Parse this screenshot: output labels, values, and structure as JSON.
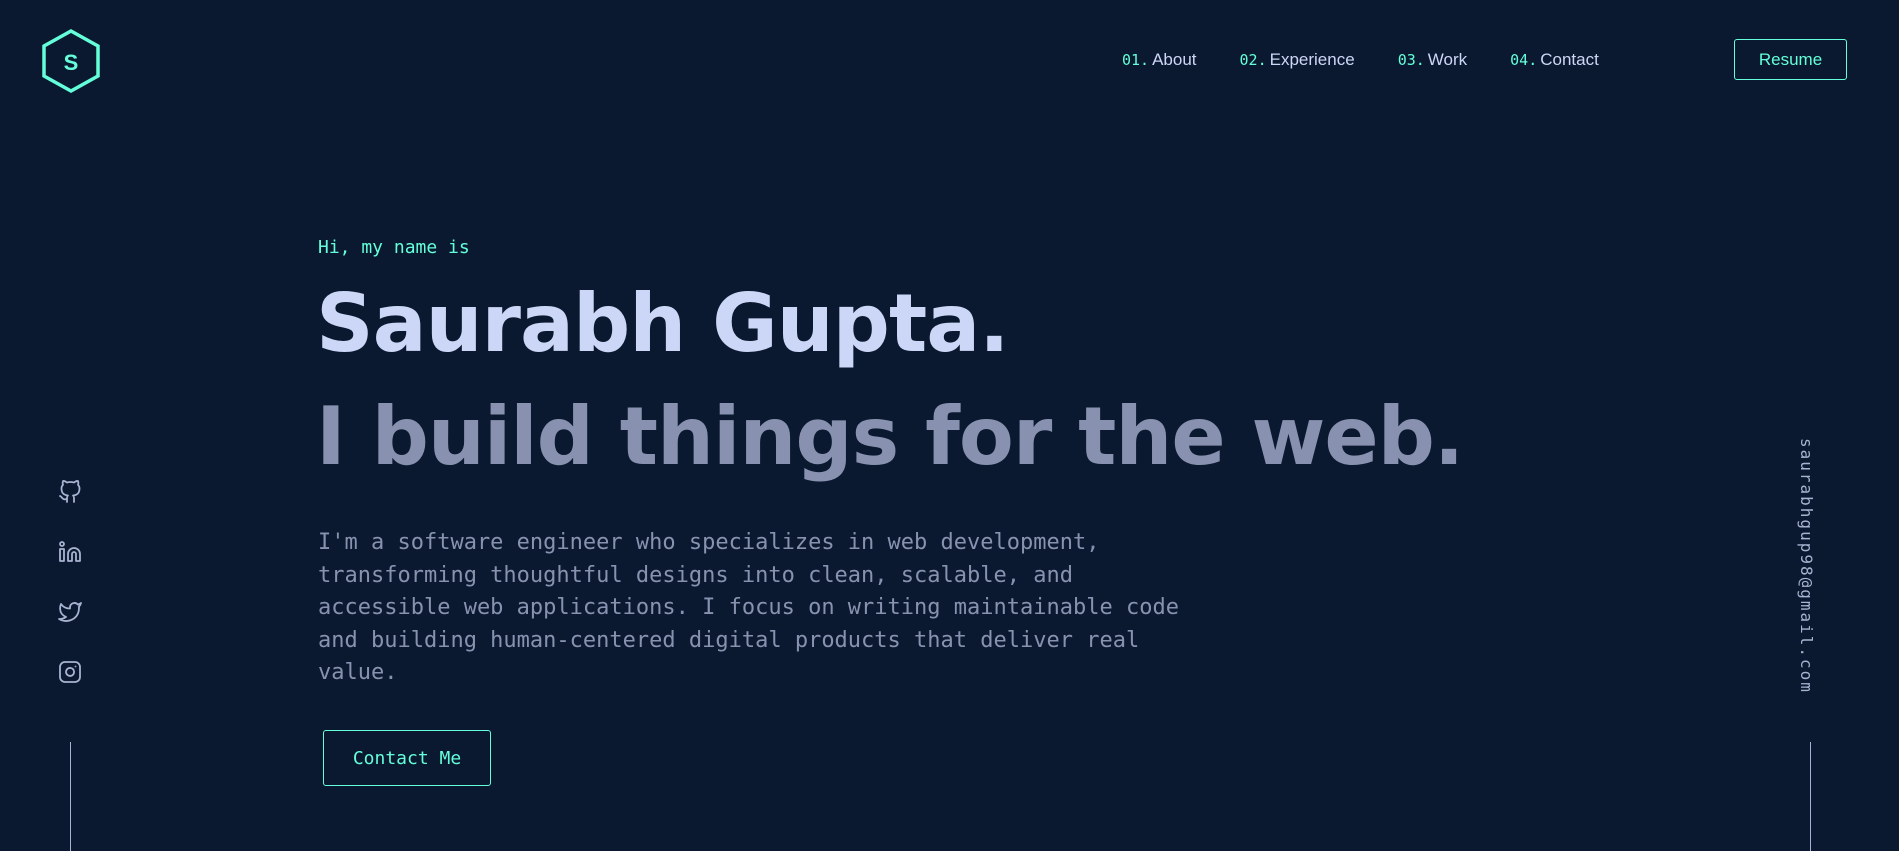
{
  "logo": {
    "letter": "S",
    "icon": "hexagon-logo-icon"
  },
  "nav": {
    "items": [
      {
        "num": "01.",
        "label": "About"
      },
      {
        "num": "02.",
        "label": "Experience"
      },
      {
        "num": "03.",
        "label": "Work"
      },
      {
        "num": "04.",
        "label": "Contact"
      }
    ],
    "resume_label": "Resume"
  },
  "hero": {
    "intro": "Hi, my name is",
    "name": "Saurabh Gupta.",
    "tagline": "I build things for the web.",
    "description": "I'm a software engineer who specializes in web development, transforming thoughtful designs into clean, scalable, and accessible web applications. I focus on writing maintainable code and building human-centered digital products that deliver real value.",
    "cta_label": "Contact Me"
  },
  "social": [
    {
      "icon": "github-icon"
    },
    {
      "icon": "linkedin-icon"
    },
    {
      "icon": "twitter-icon"
    },
    {
      "icon": "instagram-icon"
    }
  ],
  "email": "saurabhgup98@gmail.com",
  "colors": {
    "background": "#0a192f",
    "accent": "#64ffda",
    "heading": "#ccd6f6",
    "muted": "#8892b0"
  }
}
